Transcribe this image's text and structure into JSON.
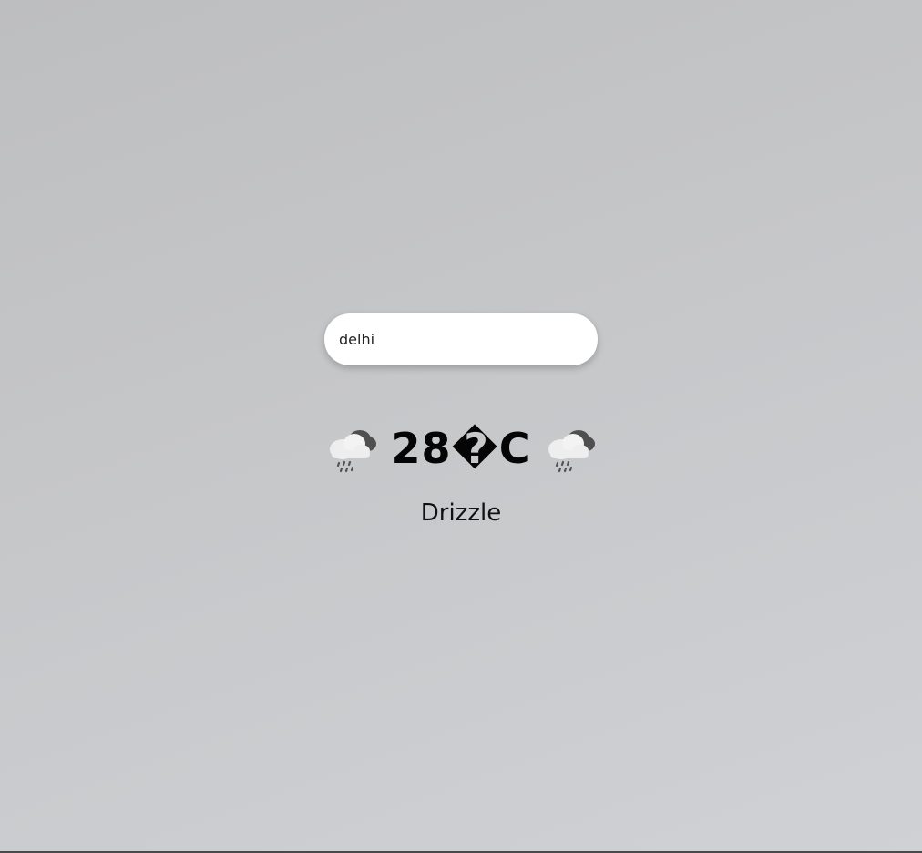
{
  "search": {
    "value": "delhi",
    "placeholder": ""
  },
  "weather": {
    "icon": "rain-cloud-icon",
    "temperature": "28�C",
    "condition": "Drizzle"
  }
}
